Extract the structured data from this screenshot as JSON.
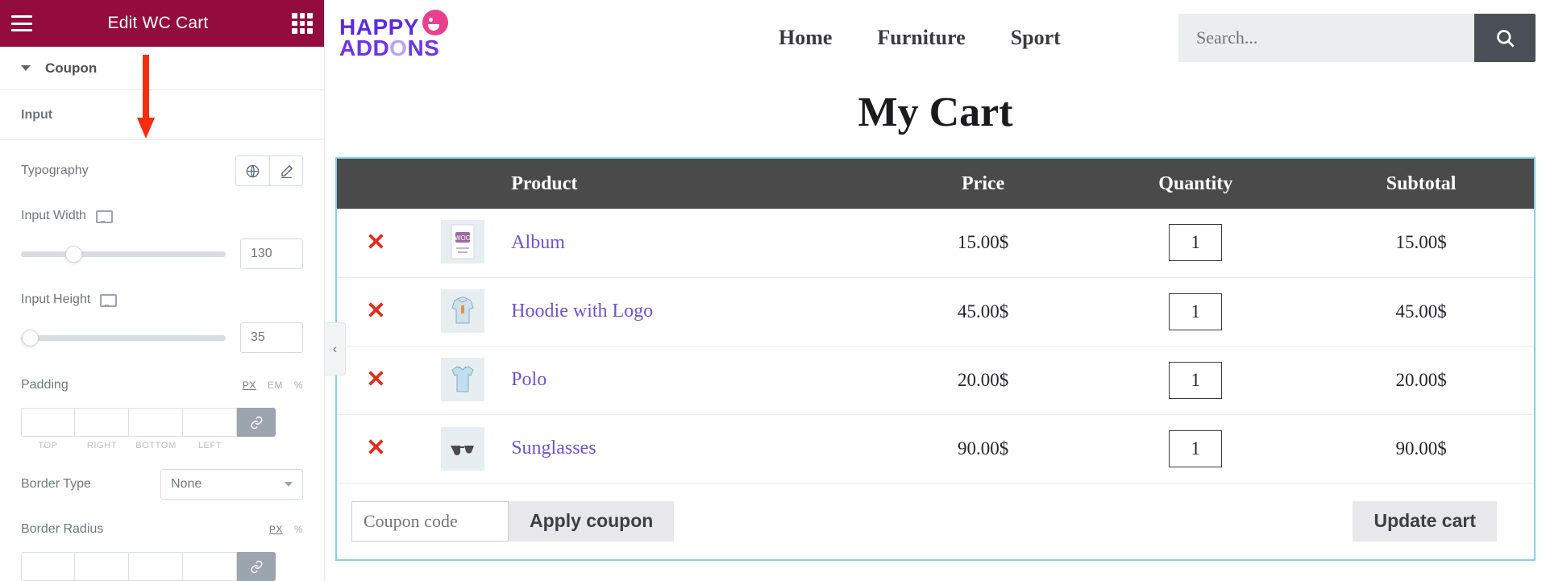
{
  "panel": {
    "title": "Edit WC Cart",
    "menu_icon": "hamburger-icon",
    "apps_icon": "grid-apps-icon",
    "section": {
      "label": "Coupon"
    },
    "subsection": {
      "label": "Input"
    },
    "controls": {
      "typography": {
        "label": "Typography",
        "global_icon": "globe-icon",
        "edit_icon": "pencil-icon"
      },
      "input_width": {
        "label": "Input Width",
        "device_icon": "desktop-icon",
        "value": "130"
      },
      "input_height": {
        "label": "Input Height",
        "device_icon": "desktop-icon",
        "value": "35"
      },
      "padding": {
        "label": "Padding",
        "units": [
          "PX",
          "EM",
          "%"
        ],
        "active_unit": "PX",
        "sides": [
          "TOP",
          "RIGHT",
          "BOTTOM",
          "LEFT"
        ],
        "values": [
          "",
          "",
          "",
          ""
        ],
        "link_icon": "link-icon"
      },
      "border_type": {
        "label": "Border Type",
        "value": "None"
      },
      "border_radius": {
        "label": "Border Radius",
        "units": [
          "PX",
          "%"
        ],
        "active_unit": "PX",
        "values": [
          "",
          "",
          "",
          ""
        ],
        "link_icon": "link-icon"
      }
    },
    "collapse_handle_icon": "chevron-left-icon",
    "annotation_arrow_color": "#f92b10"
  },
  "preview": {
    "logo": {
      "line1": "HAPPY",
      "line2_pre": "ADD",
      "line2_o": "O",
      "line2_post": "NS",
      "face_icon": "smiley-face-icon"
    },
    "nav": [
      {
        "label": "Home"
      },
      {
        "label": "Furniture"
      },
      {
        "label": "Sport"
      }
    ],
    "search": {
      "placeholder": "Search...",
      "value": "",
      "icon": "search-icon"
    },
    "page_title": "My Cart",
    "cart": {
      "columns": [
        "",
        "",
        "Product",
        "Price",
        "Quantity",
        "Subtotal"
      ],
      "rows": [
        {
          "remove": "✕",
          "thumb": "album-thumb",
          "name": "Album",
          "price": "15.00$",
          "qty": "1",
          "subtotal": "15.00$"
        },
        {
          "remove": "✕",
          "thumb": "hoodie-thumb",
          "name": "Hoodie with Logo",
          "price": "45.00$",
          "qty": "1",
          "subtotal": "45.00$"
        },
        {
          "remove": "✕",
          "thumb": "polo-thumb",
          "name": "Polo",
          "price": "20.00$",
          "qty": "1",
          "subtotal": "20.00$"
        },
        {
          "remove": "✕",
          "thumb": "sunglasses-thumb",
          "name": "Sunglasses",
          "price": "90.00$",
          "qty": "1",
          "subtotal": "90.00$"
        }
      ],
      "coupon_placeholder": "Coupon code",
      "coupon_value": "",
      "apply_label": "Apply coupon",
      "update_label": "Update cart"
    }
  },
  "colors": {
    "panel_header": "#930c3c",
    "table_header": "#4a4a4a",
    "link": "#6c54d3",
    "remove": "#e32b1f",
    "cart_border": "#7fd4e8"
  }
}
